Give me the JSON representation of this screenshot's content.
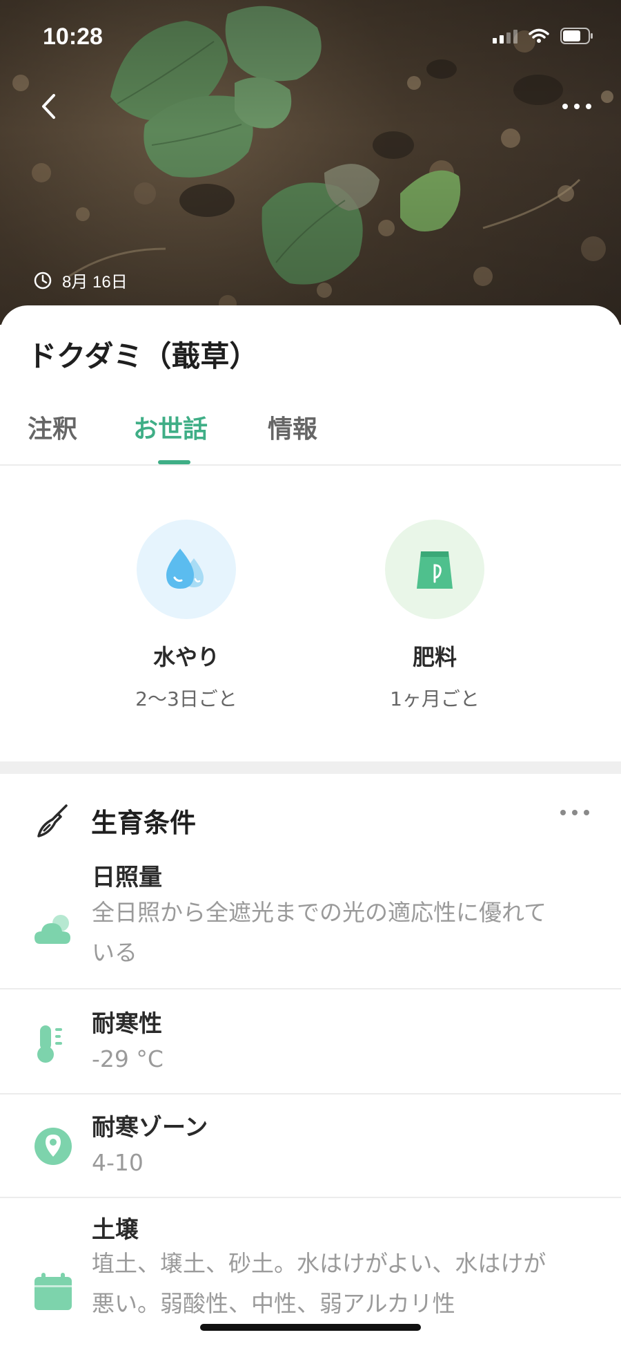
{
  "status_bar": {
    "time": "10:28"
  },
  "photo": {
    "date": "8月 16日"
  },
  "plant": {
    "name": "ドクダミ（蕺草）"
  },
  "tabs": [
    {
      "label": "注釈",
      "active": false
    },
    {
      "label": "お世話",
      "active": true
    },
    {
      "label": "情報",
      "active": false
    }
  ],
  "care": {
    "watering": {
      "title": "水やり",
      "frequency": "2〜3日ごと",
      "icon": "water-drops-icon"
    },
    "fertilizer": {
      "title": "肥料",
      "frequency": "1ヶ月ごと",
      "icon": "fertilizer-bag-icon"
    }
  },
  "growth": {
    "title": "生育条件",
    "icon": "trowel-icon",
    "items": [
      {
        "label": "日照量",
        "value": "全日照から全遮光までの光の適応性に優れている",
        "icon": "cloud-icon"
      },
      {
        "label": "耐寒性",
        "value": "-29 °C",
        "icon": "thermometer-icon"
      },
      {
        "label": "耐寒ゾーン",
        "value": "4-10",
        "icon": "location-pin-icon"
      },
      {
        "label": "土壌",
        "value": "埴土、壌土、砂土。水はけがよい、水はけが悪い。弱酸性、中性、弱アルカリ性",
        "icon": "soil-calendar-icon"
      }
    ]
  },
  "colors": {
    "accent": "#3fae86",
    "icon_green": "#7dd3ac",
    "water_bg": "#e6f4fd",
    "fert_bg": "#e9f6e8"
  }
}
